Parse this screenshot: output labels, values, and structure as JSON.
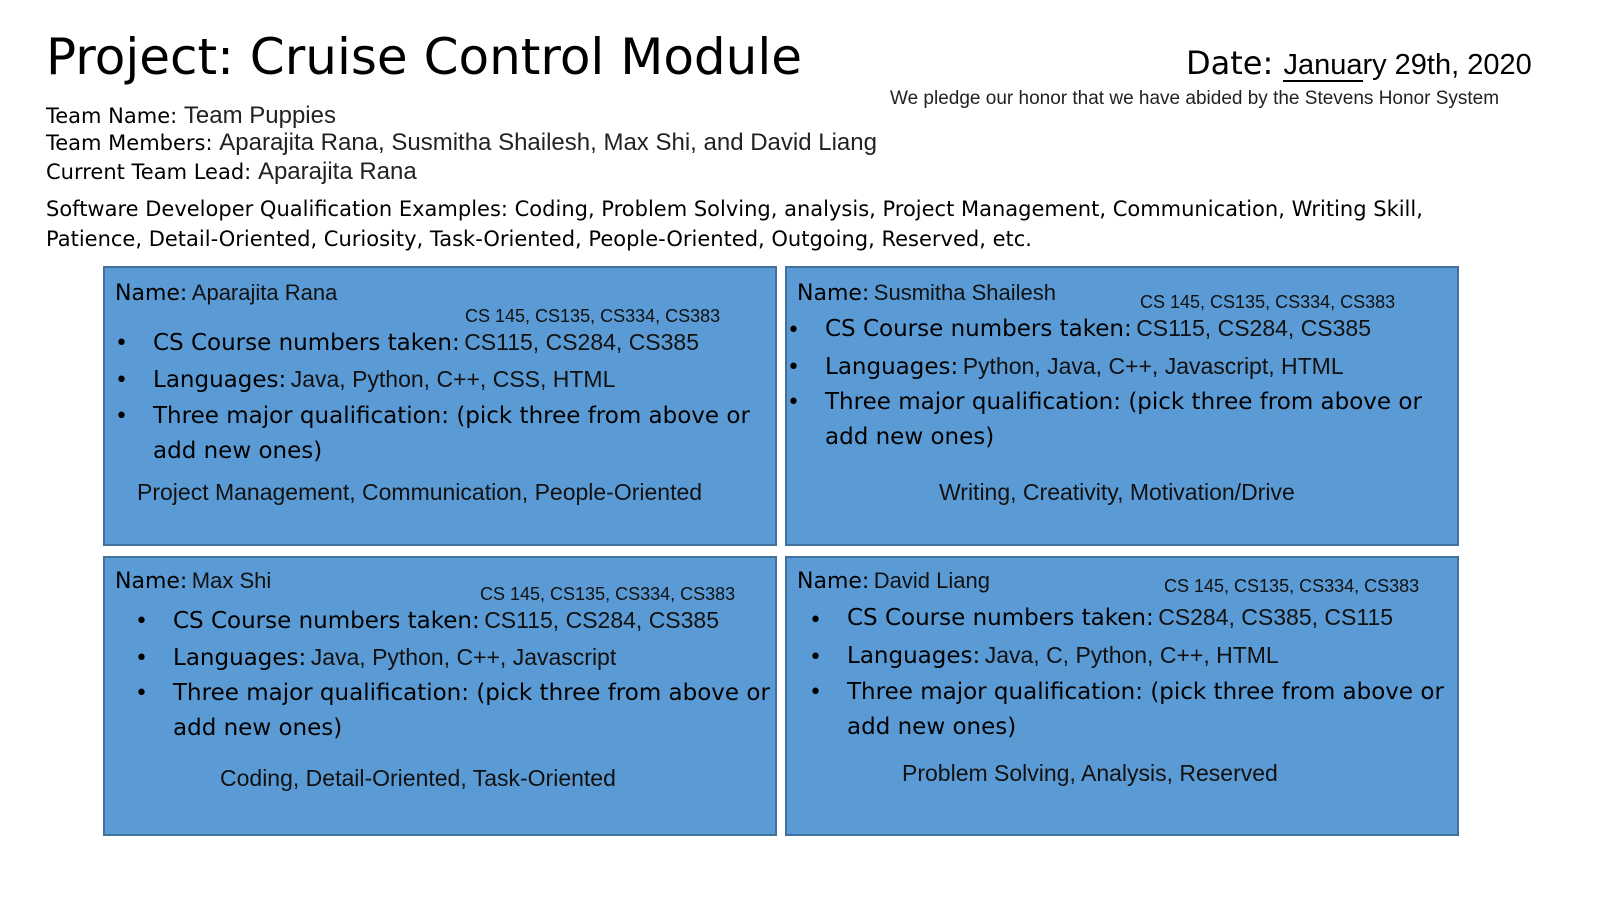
{
  "header": {
    "title": "Project: Cruise Control Module",
    "date_label": "Date: ",
    "date_value": "January 29th, 2020",
    "pledge": "We pledge our honor that we have abided by the Stevens Honor System"
  },
  "team": {
    "name_label": "Team Name: ",
    "name_value": "Team Puppies",
    "members_label": "Team Members: ",
    "members_value": "Aparajita Rana, Susmitha Shailesh, Max Shi, and David Liang",
    "lead_label": "Current Team Lead: ",
    "lead_value": "Aparajita Rana",
    "qualification_examples": "Software Developer Qualification Examples: Coding, Problem Solving, analysis, Project Management, Communication, Writing Skill, Patience, Detail-Oriented,  Curiosity, Task-Oriented, People-Oriented, Outgoing, Reserved, etc."
  },
  "labels": {
    "name": "Name:",
    "courses": "CS Course numbers taken:",
    "languages": "Languages:",
    "qualification": "Three major qualification: (pick three from above or add new ones)",
    "bullet": "•"
  },
  "members": [
    {
      "name": "Aparajita Rana",
      "courses_extra": "CS 145, CS135, CS334, CS383",
      "courses": "CS115, CS284, CS385",
      "languages": "Java, Python, C++, CSS, HTML",
      "qualifications": "Project Management, Communication, People-Oriented"
    },
    {
      "name": "Susmitha Shailesh",
      "courses_extra": "CS 145, CS135, CS334, CS383",
      "courses": "CS115, CS284, CS385",
      "languages": "Python, Java, C++, Javascript, HTML",
      "qualifications": "Writing, Creativity, Motivation/Drive"
    },
    {
      "name": "Max Shi",
      "courses_extra": "CS 145, CS135, CS334, CS383",
      "courses": "CS115, CS284, CS385",
      "languages": "Java, Python, C++, Javascript",
      "qualifications": "Coding, Detail-Oriented, Task-Oriented"
    },
    {
      "name": "David Liang",
      "courses_extra": "CS 145, CS135, CS334, CS383",
      "courses": "CS284, CS385, CS115",
      "languages": "Java, C, Python, C++, HTML",
      "qualifications": "Problem Solving, Analysis, Reserved"
    }
  ],
  "colors": {
    "card_fill": "#5b9bd5",
    "card_border": "#41719c"
  }
}
